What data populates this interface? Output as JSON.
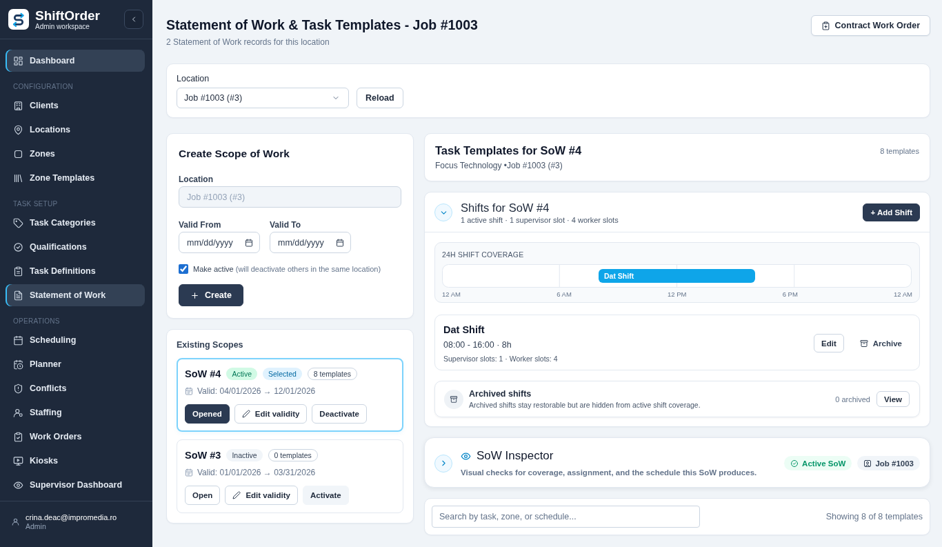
{
  "sidebar": {
    "brand": {
      "name": "ShiftOrder",
      "subtitle": "Admin workspace"
    },
    "groups": [
      {
        "items": [
          {
            "label": "Dashboard",
            "selected": true
          }
        ]
      },
      {
        "heading": "CONFIGURATION",
        "items": [
          {
            "label": "Clients",
            "selected": false
          },
          {
            "label": "Locations",
            "selected": false
          },
          {
            "label": "Zones",
            "selected": false
          },
          {
            "label": "Zone Templates",
            "selected": false
          }
        ]
      },
      {
        "heading": "TASK SETUP",
        "items": [
          {
            "label": "Task Categories",
            "selected": false
          },
          {
            "label": "Qualifications",
            "selected": false
          },
          {
            "label": "Task Definitions",
            "selected": false
          },
          {
            "label": "Statement of Work",
            "selected": true
          }
        ]
      },
      {
        "heading": "OPERATIONS",
        "items": [
          {
            "label": "Scheduling",
            "selected": false
          },
          {
            "label": "Planner",
            "selected": false
          },
          {
            "label": "Conflicts",
            "selected": false
          },
          {
            "label": "Staffing",
            "selected": false
          },
          {
            "label": "Work Orders",
            "selected": false
          },
          {
            "label": "Kiosks",
            "selected": false
          },
          {
            "label": "Supervisor Dashboard",
            "selected": false
          }
        ]
      }
    ],
    "user": {
      "email": "crina.deac@impromedia.ro",
      "role": "Admin"
    }
  },
  "header": {
    "title": "Statement of Work & Task Templates - Job #1003",
    "subtitle": "2 Statement of Work records for this location",
    "action": "Contract Work Order"
  },
  "location_bar": {
    "label": "Location",
    "value": "Job #1003 (#3)",
    "button": "Reload"
  },
  "create_form": {
    "title": "Create Scope of Work",
    "location": {
      "label": "Location",
      "value": "Job #1003 (#3)",
      "disabled": true
    },
    "valid_from": {
      "label": "Valid From",
      "placeholder": "mm/dd/yyyy"
    },
    "valid_to": {
      "label": "Valid To",
      "placeholder": "mm/dd/yyyy"
    },
    "make_active": {
      "label": "Make active",
      "hint": "(will deactivate others in the same location)",
      "checked": true
    },
    "button": "Create"
  },
  "existing_scopes": {
    "title": "Existing Scopes",
    "items": [
      {
        "name": "SoW #4",
        "active": true,
        "status": "Active",
        "selected": true,
        "selected_label": "Selected",
        "templates": "8 templates",
        "validity": "Valid: 04/01/2026 → 12/01/2026",
        "actions": [
          {
            "label": "Opened",
            "kind": "filled"
          },
          {
            "label": "Edit validity",
            "kind": "edit"
          },
          {
            "label": "Deactivate",
            "kind": "outline"
          }
        ]
      },
      {
        "name": "SoW #3",
        "active": false,
        "status": "Inactive",
        "selected": false,
        "templates": "0 templates",
        "validity": "Valid: 01/01/2026 → 03/31/2026",
        "actions": [
          {
            "label": "Open",
            "kind": "outline"
          },
          {
            "label": "Edit validity",
            "kind": "edit"
          },
          {
            "label": "Activate",
            "kind": "soft"
          }
        ]
      }
    ]
  },
  "task_templates": {
    "title": "Task Templates for SoW #4",
    "subtitle": "Focus Technology •Job #1003 (#3)",
    "count": "8 templates"
  },
  "shifts": {
    "title": "Shifts for SoW #4",
    "summary": "1 active shift · 1 supervisor slot · 4 worker slots",
    "expanded": true,
    "add_button": "+ Add Shift",
    "coverage": {
      "title": "24H SHIFT COVERAGE",
      "bars": [
        {
          "label": "Dat Shift"
        }
      ],
      "axis_labels": [
        "12 AM",
        "6 AM",
        "12 PM",
        "6 PM",
        "12 AM"
      ]
    },
    "items": [
      {
        "name": "Dat Shift",
        "time": "08:00 - 16:00 · 8h",
        "slots": "Supervisor slots: 1 · Worker slots: 4",
        "actions": [
          {
            "label": "Edit",
            "kind": "outline"
          },
          {
            "label": "Archive",
            "kind": "archive"
          }
        ]
      }
    ],
    "archived": {
      "title": "Archived shifts",
      "description": "Archived shifts stay restorable but are hidden from active shift coverage.",
      "count": "0 archived",
      "button": "View"
    }
  },
  "inspector": {
    "title": "SoW Inspector",
    "description": "Visual checks for coverage, assignment, and the schedule this SoW produces.",
    "expanded": false,
    "badges": [
      {
        "label": "Active SoW",
        "kind": "status"
      },
      {
        "label": "Job #1003",
        "kind": "job"
      }
    ]
  },
  "search": {
    "placeholder": "Search by task, zone, or schedule...",
    "result": "Showing 8 of 8 templates"
  }
}
